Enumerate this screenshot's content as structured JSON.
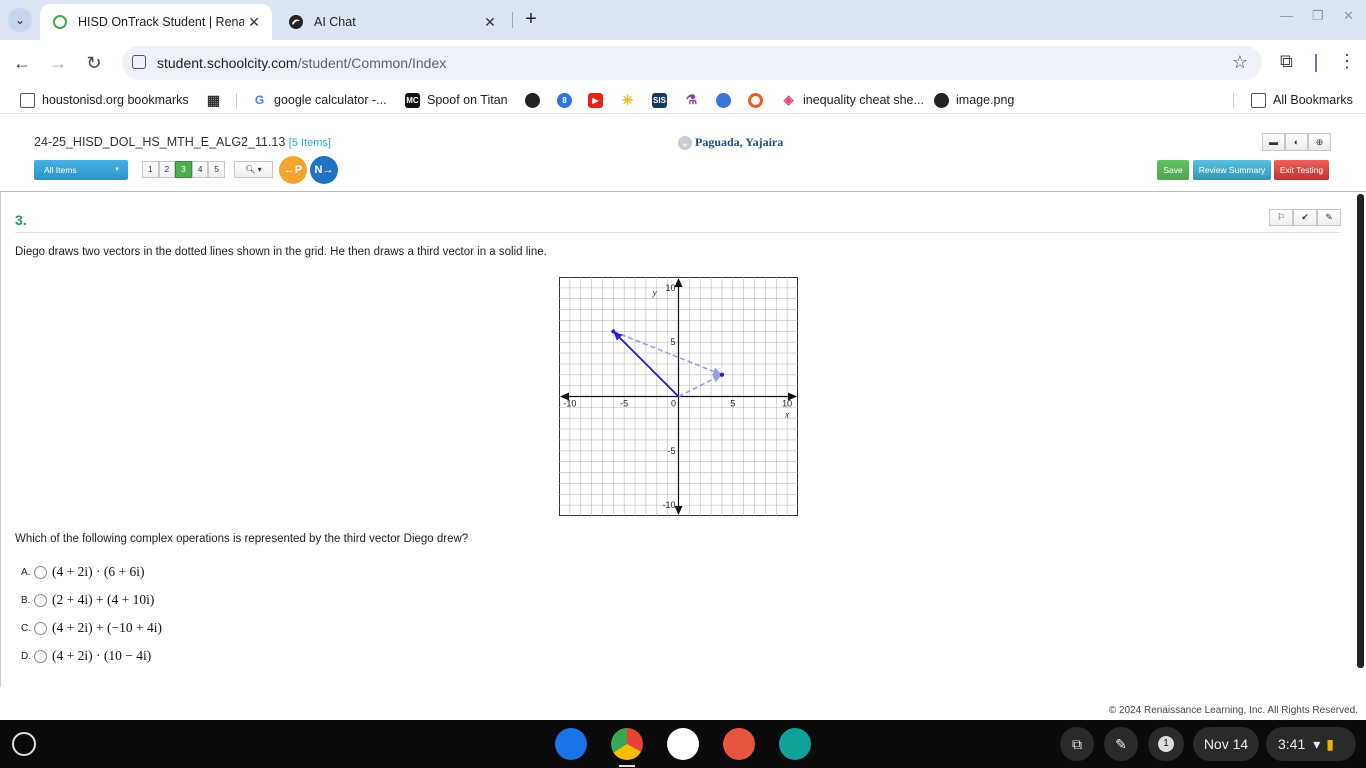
{
  "browser": {
    "tabs": [
      {
        "title": "HISD OnTrack Student | Renais",
        "active": true
      },
      {
        "title": "AI Chat",
        "active": false
      }
    ],
    "url_host": "student.schoolcity.com",
    "url_path": "/student/Common/Index",
    "bookmarks": [
      {
        "label": "houstonisd.org bookmarks"
      },
      {
        "label": "google calculator -..."
      },
      {
        "label": "Spoof on Titan"
      },
      {
        "label": "inequality cheat she..."
      },
      {
        "label": "image.png"
      },
      {
        "label": "All Bookmarks"
      }
    ]
  },
  "header": {
    "test_title": "24-25_HISD_DOL_HS_MTH_E_ALG2_11.13",
    "item_count": "[5 Items]",
    "student_name": "Paguada, Yajaira",
    "all_items_label": "All Items",
    "question_numbers": [
      "1",
      "2",
      "3",
      "4",
      "5"
    ],
    "current_question_index": 2,
    "prev_label": "P",
    "next_label": "N",
    "save_label": "Save",
    "review_label": "Review Summary",
    "exit_label": "Exit Testing"
  },
  "question": {
    "number": "3.",
    "stem": "Diego draws two vectors in the dotted lines shown in the grid. He then draws a third vector in a solid line.",
    "prompt": "Which of the following complex operations is represented by the third vector Diego drew?",
    "choices": [
      {
        "letter": "A.",
        "text": "(4 + 2i) · (6 + 6i)"
      },
      {
        "letter": "B.",
        "text": "(2 + 4i) + (4 + 10i)"
      },
      {
        "letter": "C.",
        "text": "(4 + 2i) + (−10 + 4i)"
      },
      {
        "letter": "D.",
        "text": "(4 + 2i) · (10 − 4i)"
      }
    ]
  },
  "graph": {
    "x_label": "x",
    "y_label": "y",
    "x_range": [
      -11,
      11
    ],
    "y_range": [
      -11,
      11
    ],
    "tick_labels_x": [
      "-10",
      "-5",
      "0",
      "5",
      "10"
    ],
    "tick_labels_y": [
      "10",
      "5",
      "-5",
      "-10"
    ],
    "dotted_vectors": [
      {
        "from": [
          0,
          0
        ],
        "to": [
          4,
          2
        ]
      },
      {
        "from": [
          -6,
          6
        ],
        "to": [
          4,
          2
        ]
      }
    ],
    "solid_vector": {
      "from": [
        0,
        0
      ],
      "to": [
        -6,
        6
      ]
    },
    "colors": {
      "solid": "#1f1fd8",
      "dotted": "#9a9aef"
    }
  },
  "footer": {
    "copyright": "© 2024 Renaissance Learning, Inc. All Rights Reserved."
  },
  "shelf": {
    "notifications": "1",
    "date": "Nov 14",
    "time": "3:41"
  }
}
